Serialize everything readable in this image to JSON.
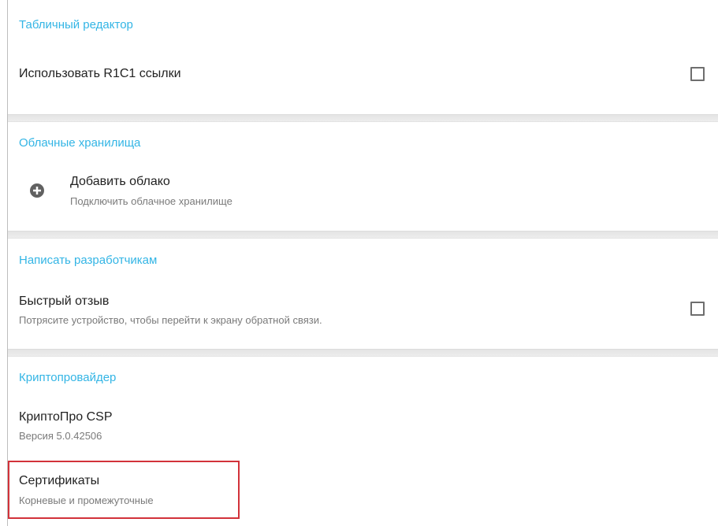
{
  "sections": {
    "spreadsheet": {
      "title": "Табличный редактор",
      "r1c1": {
        "title": "Использовать R1C1 ссылки",
        "checked": false
      }
    },
    "cloud": {
      "title": "Облачные хранилища",
      "add_cloud": {
        "title": "Добавить облако",
        "subtitle": "Подключить облачное хранилище",
        "icon": "plus-circle-icon"
      }
    },
    "developers": {
      "title": "Написать разработчикам",
      "feedback": {
        "title": "Быстрый отзыв",
        "subtitle": "Потрясите устройство, чтобы перейти к экрану обратной связи.",
        "checked": false
      }
    },
    "crypto": {
      "title": "Криптопровайдер",
      "cryptopro": {
        "title": "КриптоПро CSP",
        "subtitle": "Версия 5.0.42506"
      },
      "certificates": {
        "title": "Сертификаты",
        "subtitle": "Корневые и промежуточные"
      }
    }
  },
  "colors": {
    "section_title": "#33b5e5",
    "highlight_border": "#d2323a",
    "divider": "#ededed"
  }
}
